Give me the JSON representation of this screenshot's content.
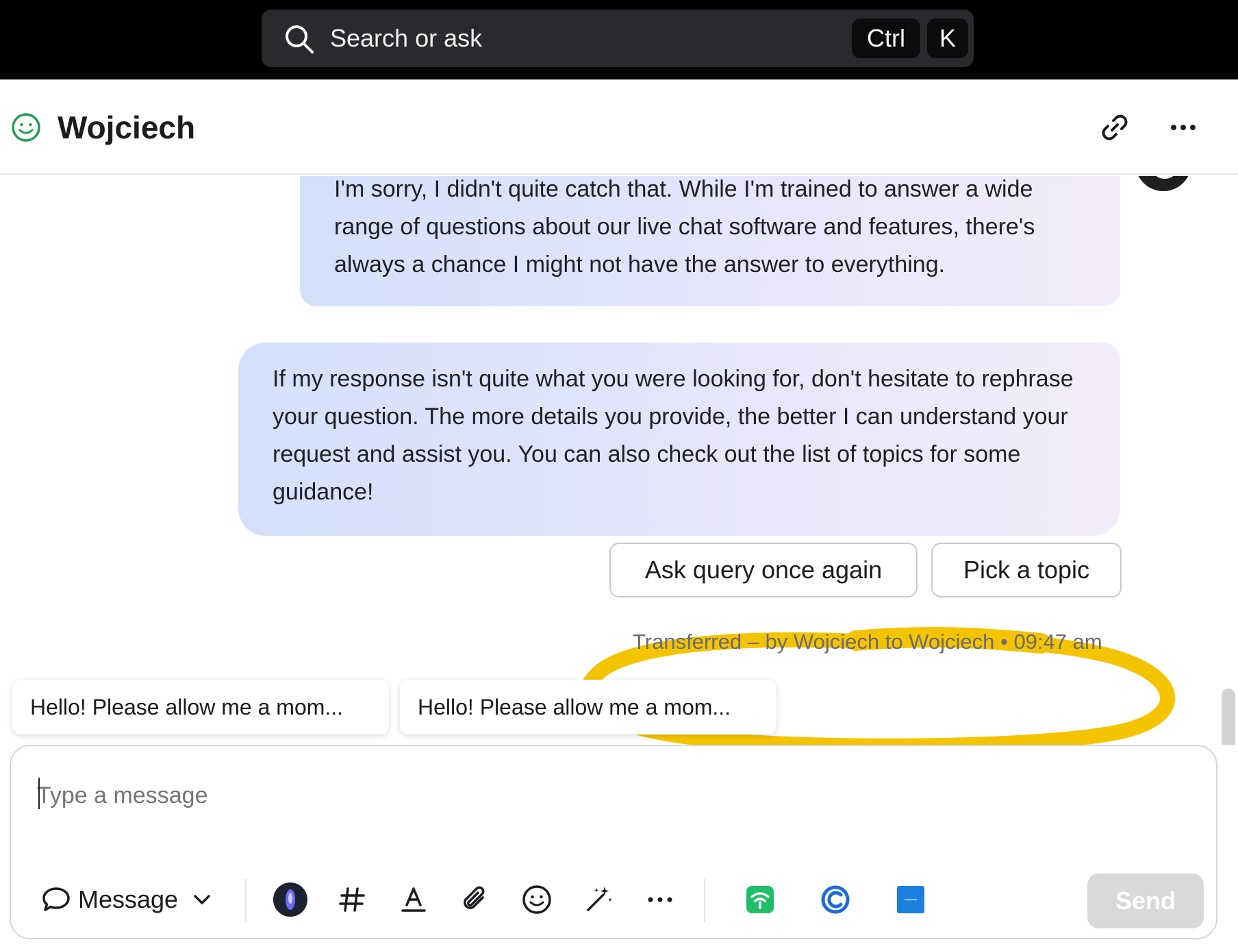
{
  "topbar": {
    "search_placeholder": "Search or ask",
    "shortcut_ctrl": "Ctrl",
    "shortcut_key": "K"
  },
  "header": {
    "title": "Wojciech"
  },
  "messages": [
    {
      "text": "I'm sorry, I didn't quite catch that. While I'm trained to answer a wide range of questions about our live chat software and features, there's always a chance I might not have the answer to everything."
    },
    {
      "text": "If my response isn't quite what you were looking for, don't hesitate to rephrase your question. The more details you provide, the better I can understand your request and assist you. You can also check out the list of topics for some guidance!"
    }
  ],
  "quick_replies": [
    {
      "label": "Ask query once again"
    },
    {
      "label": "Pick a topic"
    }
  ],
  "event": {
    "text": "Transferred – by Wojciech to Wojciech • 09:47 am"
  },
  "suggestions": [
    {
      "text": "Hello! Please allow me a mom..."
    },
    {
      "text": "Hello! Please allow me a mom..."
    }
  ],
  "composer": {
    "placeholder": "Type a message",
    "mode_label": "Message",
    "send_label": "Send"
  },
  "colors": {
    "accent_highlight": "#f5c400",
    "online_status": "#1f9d55"
  },
  "icons": [
    "search-icon",
    "smile-status-icon",
    "link-icon",
    "more-icon",
    "chat-bubble-icon",
    "chevron-down-icon",
    "ai-orb-icon",
    "hash-icon",
    "text-format-icon",
    "paperclip-icon",
    "emoji-icon",
    "magic-wand-icon",
    "more-options-icon",
    "wifi-app-icon",
    "c-app-icon",
    "blue-app-icon"
  ]
}
